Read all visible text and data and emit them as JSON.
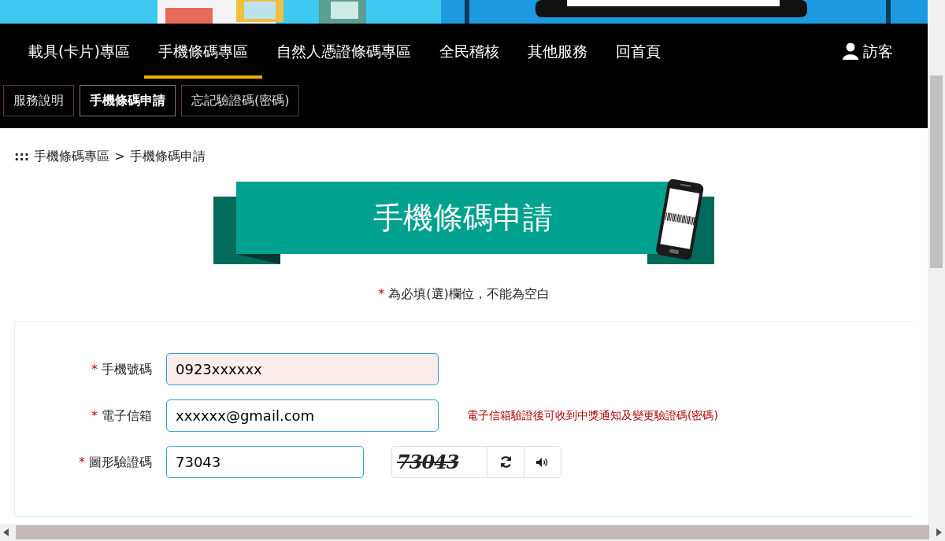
{
  "main_nav": [
    {
      "label": "載具(卡片)專區",
      "selected": false
    },
    {
      "label": "手機條碼專區",
      "selected": true
    },
    {
      "label": "自然人憑證條碼專區",
      "selected": false
    },
    {
      "label": "全民稽核",
      "selected": false
    },
    {
      "label": "其他服務",
      "selected": false
    },
    {
      "label": "回首頁",
      "selected": false
    }
  ],
  "user": {
    "label": "訪客"
  },
  "sub_nav": [
    {
      "label": "服務說明",
      "selected": false
    },
    {
      "label": "手機條碼申請",
      "selected": true
    },
    {
      "label": "忘記驗證碼(密碼)",
      "selected": false
    }
  ],
  "breadcrumb": {
    "marker": ":::",
    "items": [
      "手機條碼專區",
      "手機條碼申請"
    ],
    "separator": ">"
  },
  "banner": {
    "title": "手機條碼申請"
  },
  "required_note": {
    "star": "*",
    "text": "為必填(選)欄位，不能為空白"
  },
  "form": {
    "fields": [
      {
        "kind": "text",
        "star": "*",
        "label": "手機號碼",
        "value": "0923xxxxxx",
        "highlighted": true
      },
      {
        "kind": "text",
        "star": "*",
        "label": "電子信箱",
        "value": "xxxxxx@gmail.com",
        "highlighted": false,
        "hint": "電子信箱驗證後可收到中獎通知及變更驗證碼(密碼)"
      },
      {
        "kind": "captcha",
        "star": "*",
        "label": "圖形驗證碼",
        "value": "73043",
        "highlighted": false,
        "captcha_text": "73043"
      }
    ]
  }
}
